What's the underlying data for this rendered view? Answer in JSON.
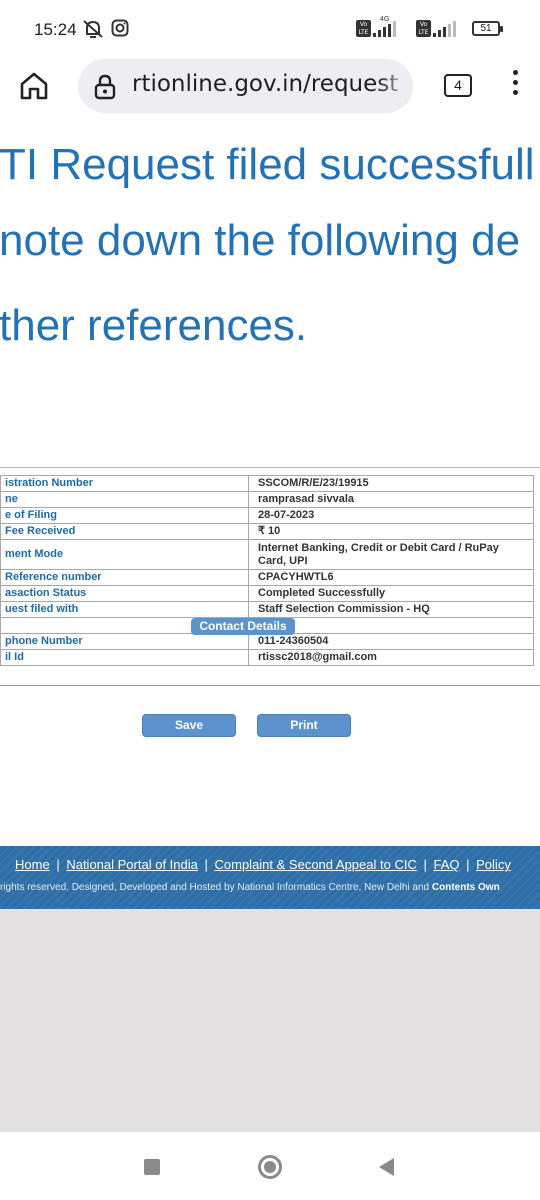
{
  "status_bar": {
    "time": "15:24",
    "battery": "51",
    "network_label": "4G",
    "volte_label": "Vo LTE"
  },
  "browser": {
    "url": "rtionline.gov.in/request",
    "tab_count": "4"
  },
  "headline": {
    "line1": "TI Request filed successfull",
    "line2": " note down the following de",
    "line3": "ther references."
  },
  "details": {
    "rows": [
      {
        "label": "istration Number",
        "value": "SSCOM/R/E/23/19915"
      },
      {
        "label": "ne",
        "value": "ramprasad sivvala"
      },
      {
        "label": "e of Filing",
        "value": "28-07-2023"
      },
      {
        "label": "Fee Received",
        "value": "₹ 10"
      },
      {
        "label": "ment Mode",
        "value": "Internet Banking, Credit or Debit Card / RuPay Card, UPI"
      },
      {
        "label": "Reference number",
        "value": "CPACYHWTL6"
      },
      {
        "label": "asaction Status",
        "value": "Completed Successfully"
      },
      {
        "label": "uest filed with",
        "value": "Staff Selection Commission - HQ"
      }
    ],
    "contact_button": "Contact Details",
    "contact_rows": [
      {
        "label": "phone Number",
        "value": "011-24360504"
      },
      {
        "label": "il Id",
        "value": "rtissc2018@gmail.com"
      }
    ]
  },
  "actions": {
    "save": "Save",
    "print": "Print"
  },
  "footer": {
    "links": [
      "Home",
      "National Portal of India",
      "Complaint & Second Appeal to CIC",
      "FAQ",
      "Policy"
    ],
    "separator": "|",
    "copyright": "rights reserved. Designed, Developed and Hosted by National Informatics Centre, New Delhi and",
    "copyright_bold": "Contents Own"
  },
  "colors": {
    "accent": "#2472b6",
    "footer": "#2f6fa8",
    "button": "#5c93cf"
  }
}
